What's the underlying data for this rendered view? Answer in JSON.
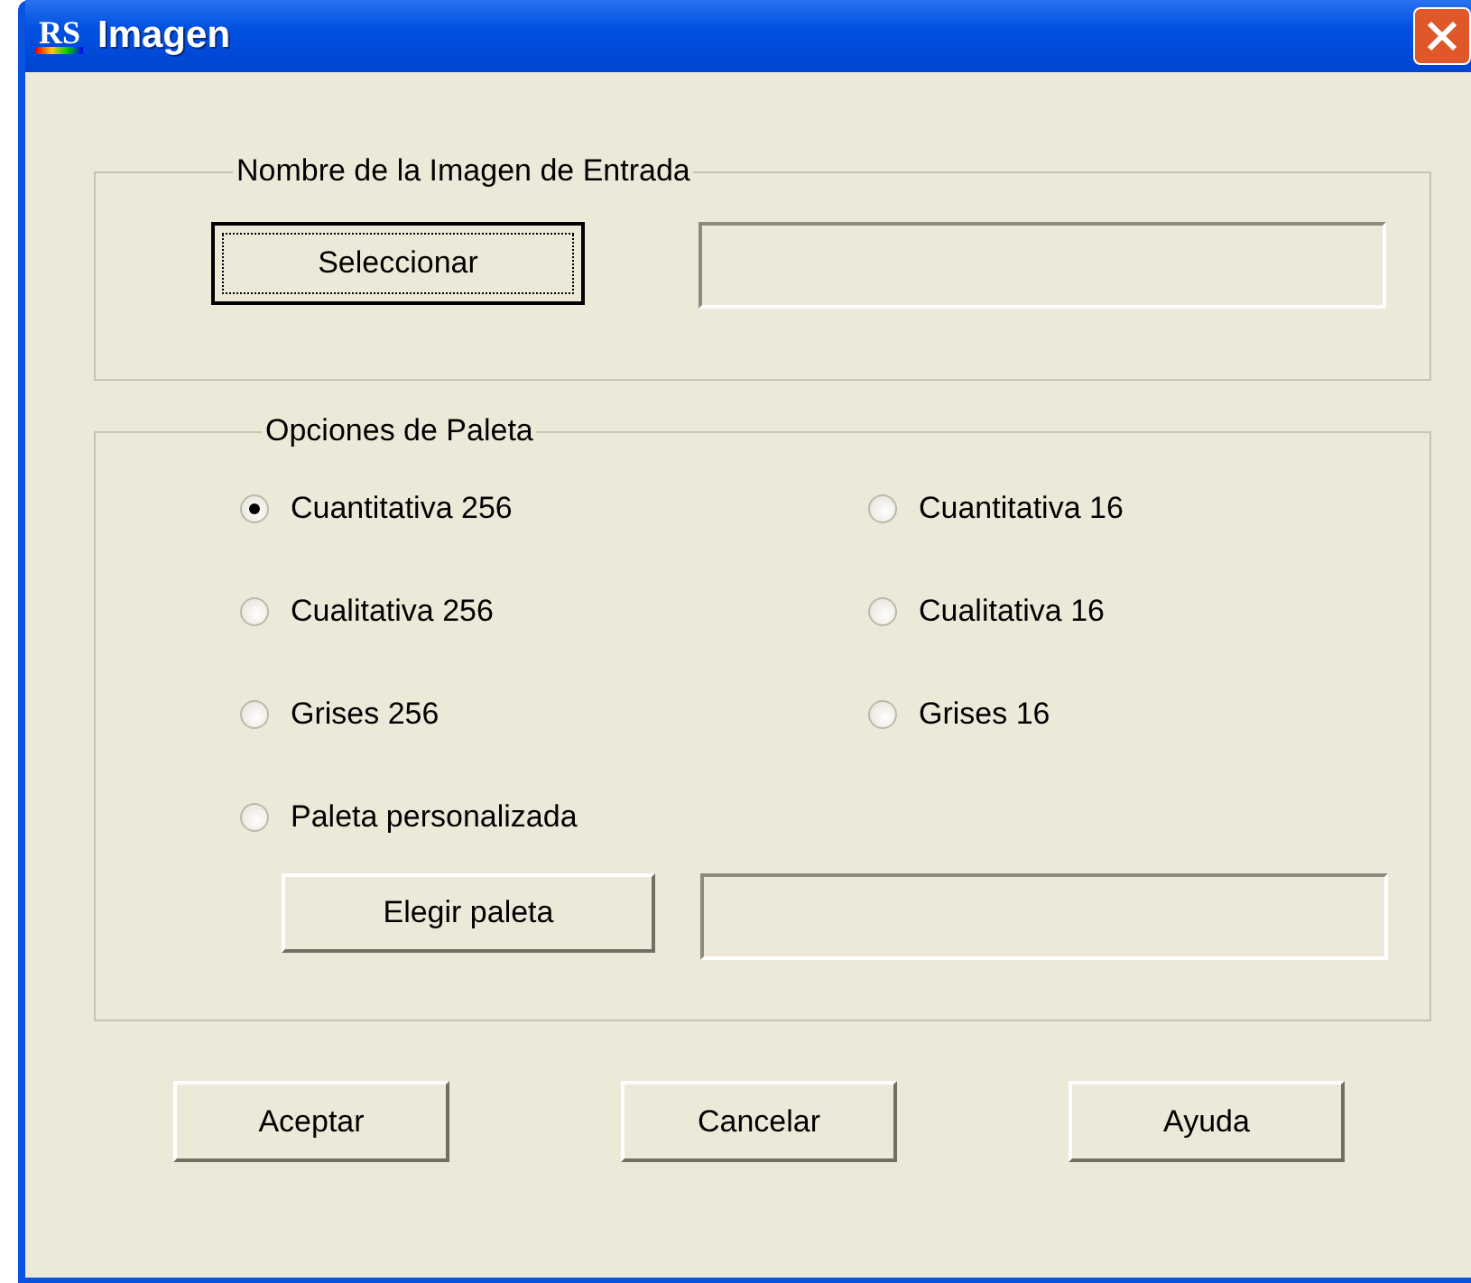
{
  "window": {
    "title": "Imagen",
    "logo": "RS"
  },
  "input_group": {
    "title": "Nombre de la Imagen de Entrada",
    "button": {
      "label": "Seleccionar",
      "focused": true
    }
  },
  "palette_group": {
    "title": "Opciones de Paleta",
    "options": [
      {
        "label": "Cuantitativa 256",
        "selected": true
      },
      {
        "label": "Cuantitativa 16",
        "selected": false
      },
      {
        "label": "Cualitativa 256",
        "selected": false
      },
      {
        "label": "Cualitativa 16",
        "selected": false
      },
      {
        "label": "Grises 256",
        "selected": false
      },
      {
        "label": "Grises 16",
        "selected": false
      },
      {
        "label": "Paleta personalizada",
        "selected": false
      }
    ],
    "button": {
      "label": "Elegir paleta",
      "focused": false
    }
  },
  "buttons": [
    {
      "label": "Aceptar"
    },
    {
      "label": "Cancelar"
    },
    {
      "label": "Ayuda"
    }
  ]
}
